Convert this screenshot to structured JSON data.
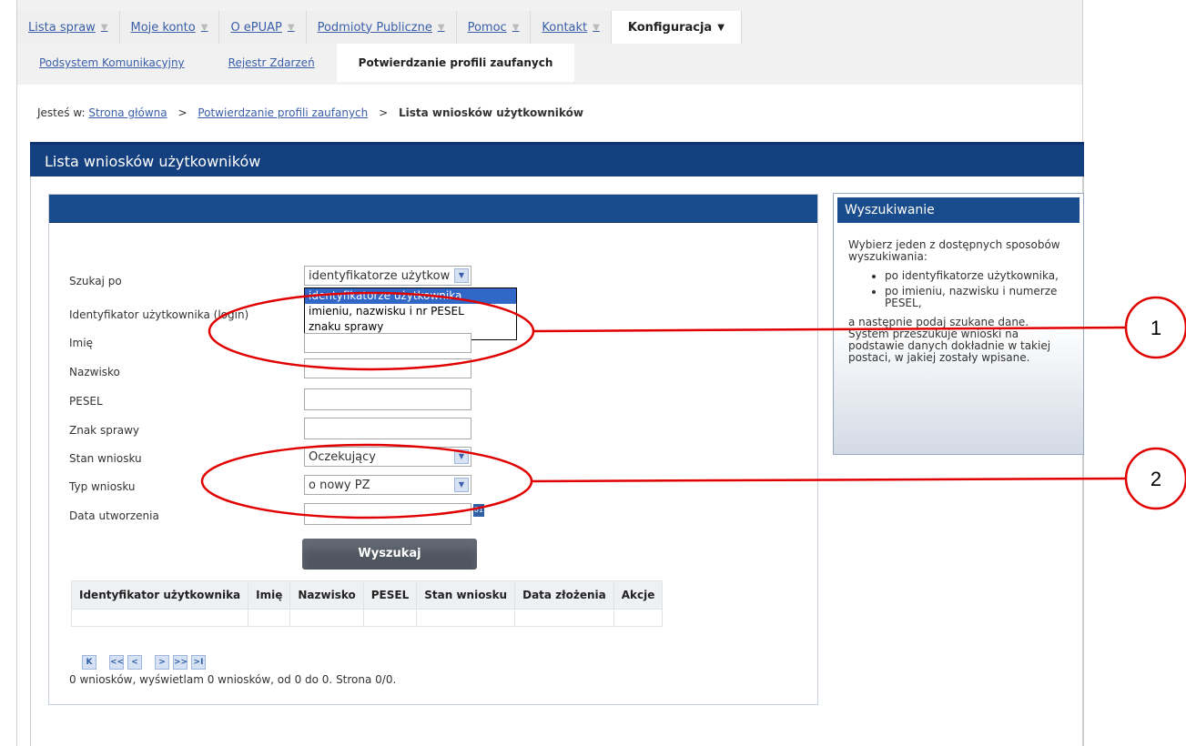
{
  "nav": {
    "main": [
      {
        "label": "Lista spraw"
      },
      {
        "label": "Moje konto"
      },
      {
        "label": "O ePUAP"
      },
      {
        "label": "Podmioty Publiczne"
      },
      {
        "label": "Pomoc"
      },
      {
        "label": "Kontakt"
      },
      {
        "label": "Konfiguracja"
      }
    ],
    "sub": [
      {
        "label": "Podsystem Komunikacyjny"
      },
      {
        "label": "Rejestr Zdarzeń"
      },
      {
        "label": "Potwierdzanie profili zaufanych"
      }
    ]
  },
  "breadcrumb": {
    "prefix": "Jesteś w:",
    "home": "Strona główna",
    "section": "Potwierdzanie profili zaufanych",
    "current": "Lista wniosków użytkowników",
    "separator": ">"
  },
  "page_title": "Lista wniosków użytkowników",
  "form": {
    "search_by_label": "Szukaj po",
    "search_by_value": "identyfikatorze użytkow",
    "search_by_options": [
      "identyfikatorze użytkownika",
      "imieniu, nazwisku i nr PESEL",
      "znaku sprawy"
    ],
    "login_label": "Identyfikator użytkownika (login)",
    "first_name_label": "Imię",
    "last_name_label": "Nazwisko",
    "pesel_label": "PESEL",
    "case_label": "Znak sprawy",
    "status_label": "Stan wniosku",
    "status_value": "Oczekujący",
    "type_label": "Typ wniosku",
    "type_value": "o nowy PZ",
    "date_label": "Data utworzenia",
    "search_button": "Wyszukaj"
  },
  "table": {
    "headers": [
      "Identyfikator użytkownika",
      "Imię",
      "Nazwisko",
      "PESEL",
      "Stan wniosku",
      "Data złożenia",
      "Akcje"
    ]
  },
  "pager": {
    "buttons": [
      "K",
      "<<",
      "<",
      ">",
      ">>",
      ">I"
    ],
    "info": "0 wniosków, wyświetlam 0 wniosków, od 0 do 0. Strona 0/0."
  },
  "sidebar": {
    "title": "Wyszukiwanie",
    "intro": "Wybierz jeden z dostępnych sposobów wyszukiwania:",
    "items": [
      "po identyfikatorze użytkownika,",
      "po imieniu, nazwisku i numerze PESEL,"
    ],
    "outro": "a następnie podaj szukane dane. System przeszukuje wnioski na podstawie danych dokładnie w takiej postaci, w jakiej zostały wpisane."
  },
  "annotations": [
    "1",
    "2"
  ],
  "colors": {
    "nav_link": "#3a5ea8",
    "title_bar": "#14407f",
    "annotation": "#e00000"
  }
}
